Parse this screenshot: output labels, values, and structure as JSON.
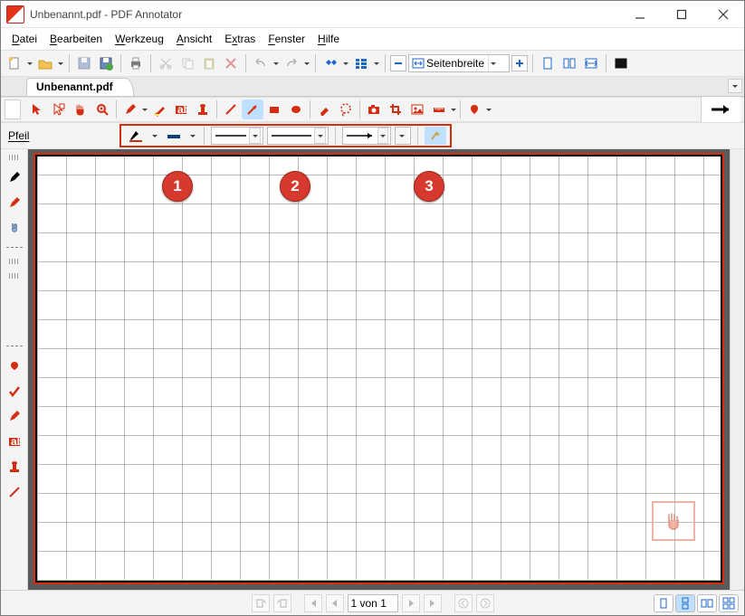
{
  "window": {
    "title": "Unbenannt.pdf - PDF Annotator"
  },
  "menu": [
    "Datei",
    "Bearbeiten",
    "Werkzeug",
    "Ansicht",
    "Extras",
    "Fenster",
    "Hilfe"
  ],
  "toolbar": {
    "zoom_mode": "Seitenbreite"
  },
  "tabs": [
    {
      "label": "Unbenannt.pdf"
    }
  ],
  "proprow": {
    "label": "Pfeil"
  },
  "callouts": [
    "1",
    "2",
    "3"
  ],
  "status": {
    "page": "1 von 1"
  }
}
